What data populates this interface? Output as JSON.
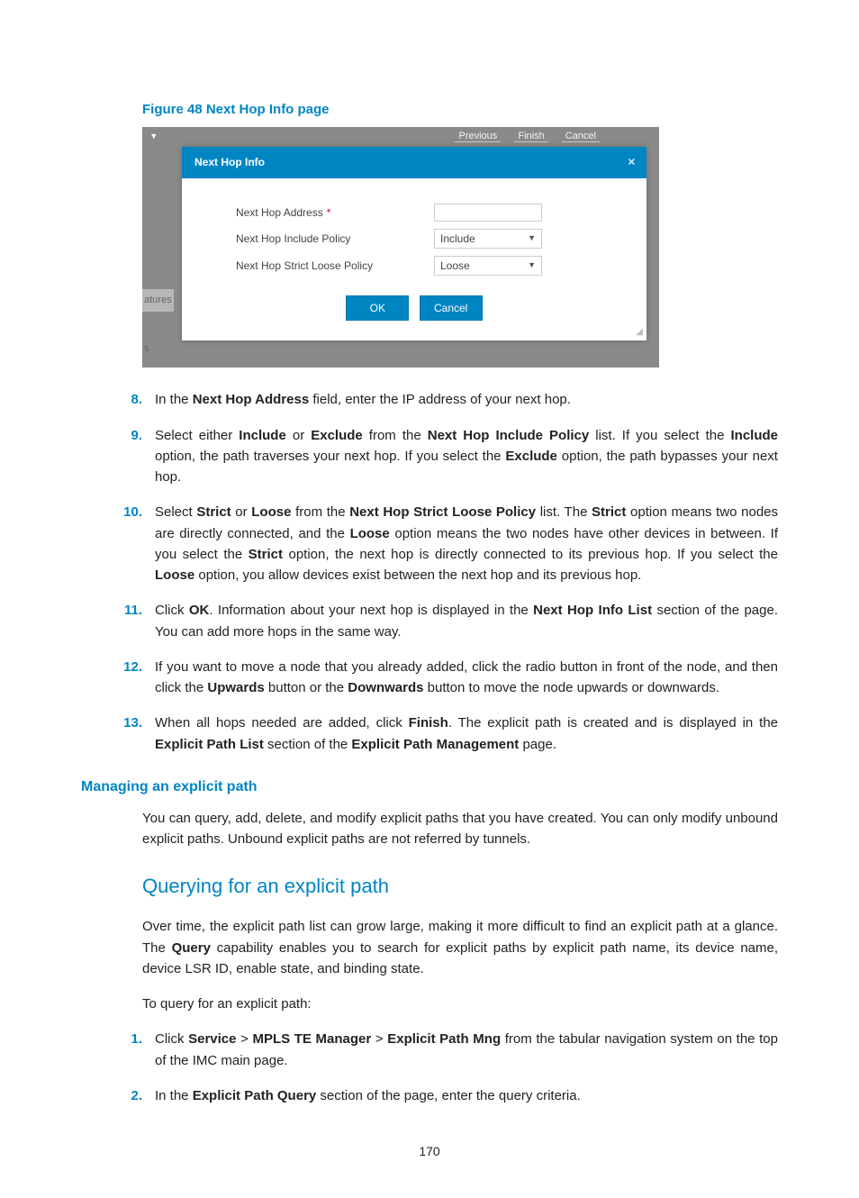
{
  "figure": {
    "caption": "Figure 48 Next Hop Info page"
  },
  "dialog": {
    "dim_btns": [
      "Previous",
      "Finish",
      "Cancel"
    ],
    "title": "Next Hop Info",
    "row1_label": "Next Hop Address",
    "row1_required": "*",
    "row1_value": "",
    "row2_label": "Next Hop Include Policy",
    "row2_value": "Include",
    "row3_label": "Next Hop Strict Loose Policy",
    "row3_value": "Loose",
    "ok": "OK",
    "cancel": "Cancel",
    "side1": "atures",
    "side2": "s"
  },
  "steps": {
    "s8_num": "8.",
    "s8": "In the <b>Next Hop Address</b> field, enter the IP address of your next hop.",
    "s9_num": "9.",
    "s9": "Select either <b>Include</b> or <b>Exclude</b> from the <b>Next Hop Include Policy</b> list. If you select the <b>Include</b> option, the path traverses your next hop. If you select the <b>Exclude</b> option, the path bypasses your next hop.",
    "s10_num": "10.",
    "s10": "Select <b>Strict</b> or <b>Loose</b> from the <b>Next Hop Strict Loose Policy</b> list. The <b>Strict</b> option means two nodes are directly connected, and the <b>Loose</b> option means the two nodes have other devices in between. If you select the <b>Strict</b> option, the next hop is directly connected to its previous hop. If you select the <b>Loose</b> option, you allow devices exist between the next hop and its previous hop.",
    "s11_num": "11.",
    "s11": "Click <b>OK</b>. Information about your next hop is displayed in the <b>Next Hop Info List</b> section of the page. You can add more hops in the same way.",
    "s12_num": "12.",
    "s12": "If you want to move a node that you already added, click the radio button in front of the node, and then click the <b>Upwards</b> button or the <b>Downwards</b> button to move the node upwards or downwards.",
    "s13_num": "13.",
    "s13": "When all hops needed are added, click <b>Finish</b>. The explicit path is created and is displayed in the <b>Explicit Path List</b> section of the <b>Explicit Path Management</b> page."
  },
  "sec1": {
    "title": "Managing an explicit path",
    "para": "You can query, add, delete, and modify explicit paths that you have created. You can only modify unbound explicit paths. Unbound explicit paths are not referred by tunnels."
  },
  "sec2": {
    "title": "Querying for an explicit path",
    "para1": "Over time, the explicit path list can grow large, making it more difficult to find an explicit path at a glance. The <b>Query</b> capability enables you to search for explicit paths by explicit path name, its device name, device LSR ID, enable state, and binding state.",
    "para2": "To query for an explicit path:"
  },
  "steps2": {
    "s1_num": "1.",
    "s1": "Click <b>Service</b> > <b>MPLS TE Manager</b> > <b>Explicit Path Mng</b> from the tabular navigation system on the top of the IMC main page.",
    "s2_num": "2.",
    "s2": "In the <b>Explicit Path Query</b> section of the page, enter the query criteria."
  },
  "pagenum": "170"
}
